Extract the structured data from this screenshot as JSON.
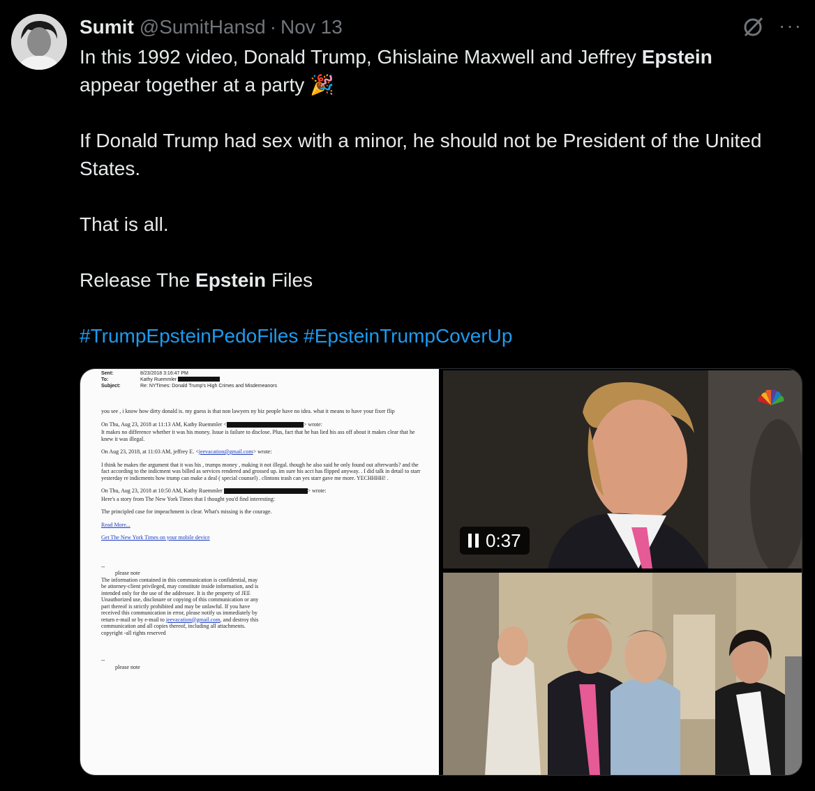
{
  "tweet": {
    "author_name": "Sumit",
    "handle": "@SumitHansd",
    "separator": "·",
    "timestamp": "Nov 13",
    "more_label": "···",
    "line1_pre": "In this 1992 video, Donald Trump, Ghislaine Maxwell and Jeffrey ",
    "line1_bold": "Epstein",
    "line2": "appear together at a party",
    "party_emoji": "🎉",
    "para2": "If Donald Trump had sex with a minor, he should not be President of the United States.",
    "para3": "That is all.",
    "para4_pre": "Release The ",
    "para4_bold": "Epstein",
    "para4_post": " Files",
    "hashtags": [
      "#TrumpEpsteinPedoFiles",
      "#EpsteinTrumpCoverUp"
    ]
  },
  "document": {
    "sent_label": "Sent:",
    "sent_value": "8/23/2018 3:16:47 PM",
    "to_label": "To:",
    "to_value": "Kathy Ruemmler",
    "subject_label": "Subject:",
    "subject_value": "Re: NYTimes: Donald Trump's High Crimes and Misdemeanors",
    "p1": "you see , i know how dirty donald is. my guess is that non lawyers ny biz people have no idea. what it means to have your fixer flip",
    "p2_head_pre": "On Thu, Aug 23, 2018 at 11:13 AM, Kathy Ruemmler <",
    "p2_head_post": "> wrote:",
    "p2_body": "It makes no difference whether it was his money. Issue is failure to disclose. Plus, fact that he has lied his ass off about it makes clear that he knew it was illegal.",
    "p3_head_pre": "On Aug 23, 2018, at 11:03 AM, jeffrey E. <",
    "p3_email": "jeevacation@gmail.com",
    "p3_head_post": "> wrote:",
    "p4": "I think he makes the argument that it was his , trumps money , making it not illegal. though he also said he only found out afterwards? and the fact according to the indicment was billed as services rendered and grossed up. im sure his acct has flipped anyway. . I did talk in detail to starr yesterday re indicments how trump can make a deal ( special counsel) . clintons trash can yes starr gave me more. YECHHHH! .",
    "p5_head_pre": "On Thu, Aug 23, 2018 at 10:50 AM, Kathy Ruemmler",
    "p5_head_post": "> wrote:",
    "p5_body": "Here's a story from The New York Times that I thought you'd find interesting:",
    "p6": "The principled case for impeachment is clear. What's missing is the courage.",
    "link1": "Read More...",
    "link2": "Get The New York Times on your mobile device",
    "dashes": "--",
    "please_note": "please note",
    "disclaimer_pre": "The information contained in this communication is confidential, may be attorney-client privileged, may constitute inside information, and is intended only for the use of the addressee. It is the property of JEE Unauthorized use, disclosure or copying of this communication or any part thereof is strictly prohibited and may be unlawful. If you have received this communication in error, please notify us immediately by return e-mail or by e-mail to ",
    "disclaimer_email": "jeevacation@gmail.com",
    "disclaimer_post": ", and destroy this communication and all copies thereof, including all attachments. copyright -all rights reserved",
    "dashes2": "--",
    "please_note2": "please note"
  },
  "video": {
    "duration": "0:37"
  }
}
